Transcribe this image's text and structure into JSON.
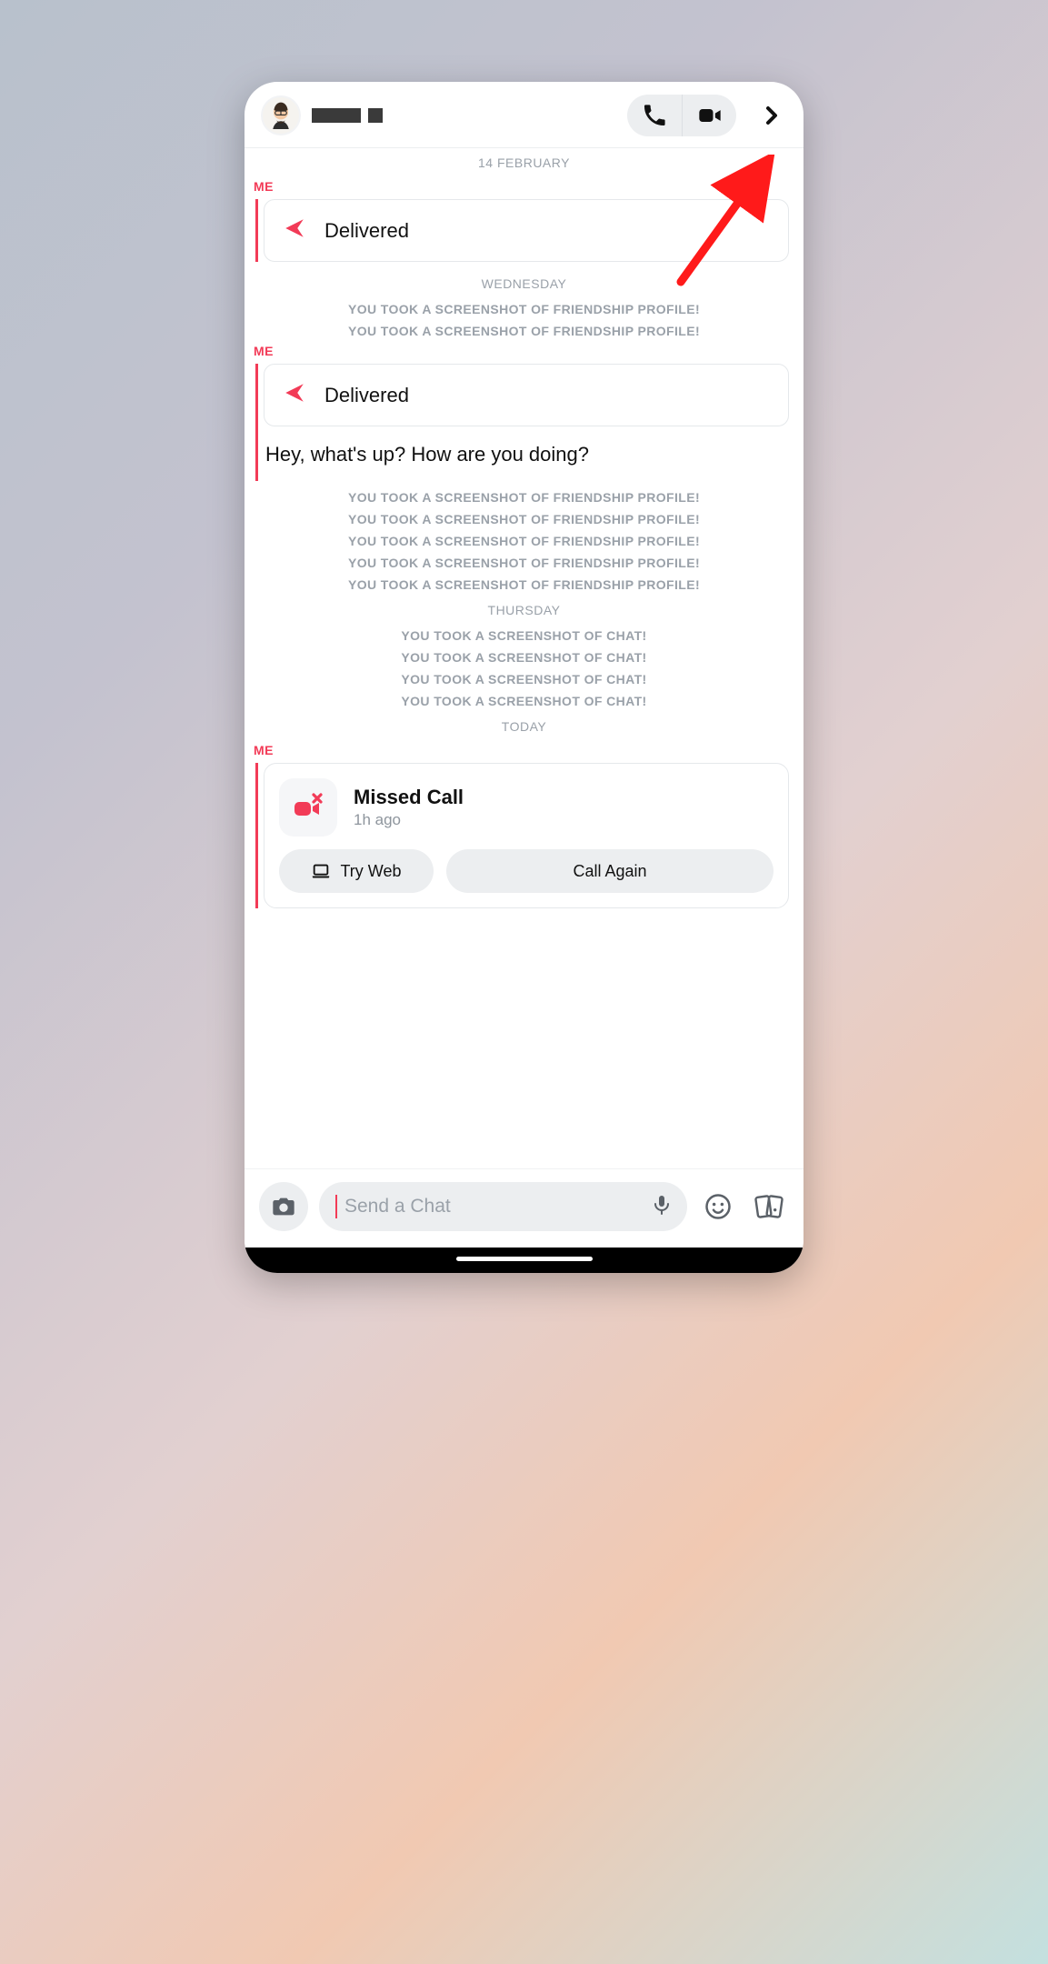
{
  "header": {
    "audio_call_aria": "Audio call",
    "video_call_aria": "Video call",
    "more_aria": "Open profile"
  },
  "thread": {
    "sep1": "14 FEBRUARY",
    "me_label": "ME",
    "delivered": "Delivered",
    "sep2": "WEDNESDAY",
    "sys_friend": "YOU TOOK A SCREENSHOT OF FRIENDSHIP PROFILE!",
    "msg1": "Hey, what's up? How are you doing?",
    "sep3": "THURSDAY",
    "sys_chat": "YOU TOOK A SCREENSHOT OF CHAT!",
    "sep4": "TODAY"
  },
  "call": {
    "title": "Missed Call",
    "subtitle": "1h ago",
    "try_web": "Try Web",
    "call_again": "Call Again"
  },
  "footer": {
    "placeholder": "Send a Chat"
  }
}
